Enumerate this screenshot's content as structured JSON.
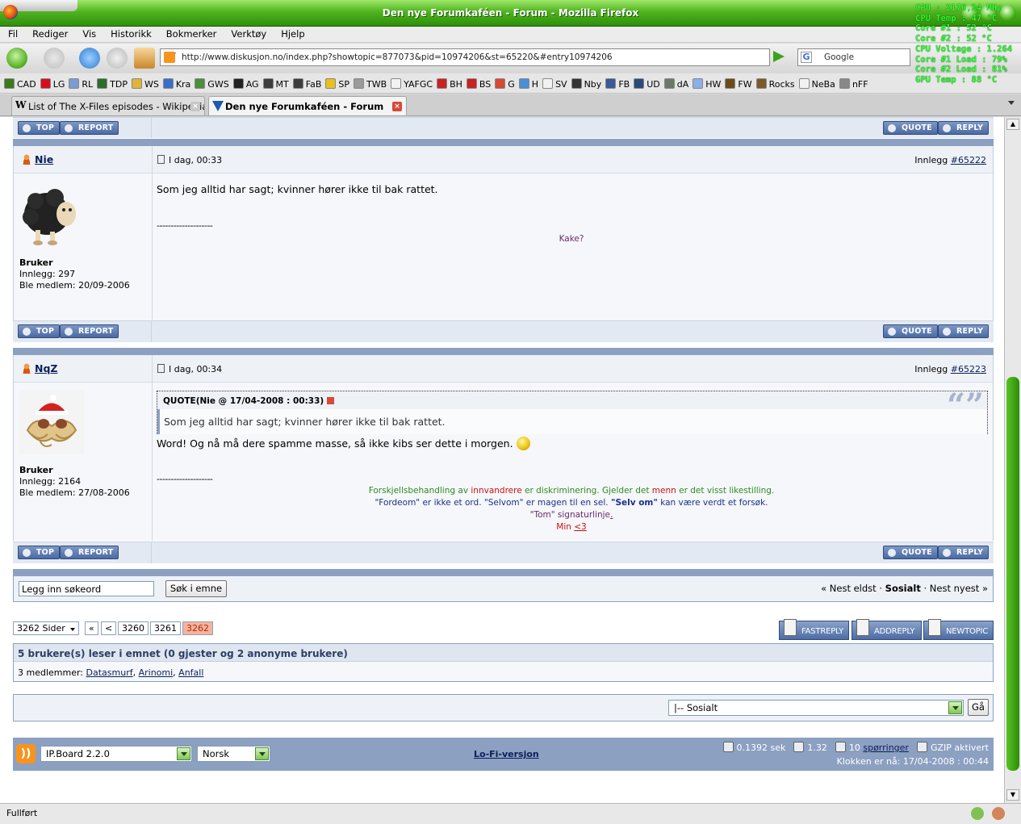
{
  "window": {
    "title": "Den nye Forumkaféen - Forum - Mozilla Firefox",
    "osd": [
      "CPU : 2176,24 MHz",
      "CPU Temp : 47 °C",
      "Core #1 : 52 °C",
      "Core #2 : 52 °C",
      "CPU Voltage : 1.264",
      "Core #1 Load : 79%",
      "Core #2 Load : 81%",
      "GPU Temp : 88 °C"
    ]
  },
  "menu": [
    "Fil",
    "Rediger",
    "Vis",
    "Historikk",
    "Bokmerker",
    "Verktøy",
    "Hjelp"
  ],
  "nav": {
    "url": "http://www.diskusjon.no/index.php?showtopic=877073&pid=10974206&st=65220&#entry10974206",
    "search_placeholder": "Google"
  },
  "bookmarks": [
    {
      "label": "CAD",
      "color": "#3a7a1a"
    },
    {
      "label": "LG",
      "color": "#d40f1c"
    },
    {
      "label": "RL",
      "color": "#7d9bd1"
    },
    {
      "label": "TDP",
      "color": "#2a6e2a"
    },
    {
      "label": "WS",
      "color": "#e0b434"
    },
    {
      "label": "Kra",
      "color": "#3b6ec9"
    },
    {
      "label": "GWS",
      "color": "#4a8f3a"
    },
    {
      "label": "AG",
      "color": "#222222"
    },
    {
      "label": "MT",
      "color": "#3d3d3d"
    },
    {
      "label": "FaB",
      "color": "#3d3d3d"
    },
    {
      "label": "SP",
      "color": "#e8c21c"
    },
    {
      "label": "TWB",
      "color": "#9a9a9a"
    },
    {
      "label": "YAFGC",
      "color": "#f2f2f2"
    },
    {
      "label": "BH",
      "color": "#c82222"
    },
    {
      "label": "BS",
      "color": "#c82222"
    },
    {
      "label": "G",
      "color": "#d64a32"
    },
    {
      "label": "H",
      "color": "#4a8fd6"
    },
    {
      "label": "SV",
      "color": "#f2f2f2"
    },
    {
      "label": "Nby",
      "color": "#333333"
    },
    {
      "label": "FB",
      "color": "#3b5998"
    },
    {
      "label": "UD",
      "color": "#2a4b7a"
    },
    {
      "label": "dA",
      "color": "#6b7a66"
    },
    {
      "label": "HW",
      "color": "#8ab0e6"
    },
    {
      "label": "FW",
      "color": "#6b4a1a"
    },
    {
      "label": "Rocks",
      "color": "#7a5a2a"
    },
    {
      "label": "NeBa",
      "color": "#f2f2f2"
    },
    {
      "label": "nFF",
      "color": "#888888"
    }
  ],
  "tabs": [
    {
      "label": "List of The X-Files episodes - Wikipedia...",
      "active": false
    },
    {
      "label": "Den nye Forumkaféen - Forum",
      "active": true
    }
  ],
  "post_buttons": {
    "top": "TOP",
    "report": "REPORT",
    "quote": "QUOTE",
    "reply": "REPLY"
  },
  "posts": [
    {
      "username": "Nie",
      "date": "I dag, 00:33",
      "post_label": "Innlegg",
      "post_number": "#65222",
      "group": "Bruker",
      "posts_count": "Innlegg: 297",
      "member_since": "Ble medlem: 20/09-2006",
      "text": "Som jeg alltid har sagt; kvinner hører ikke til bak rattet.",
      "sig_sep": "--------------------",
      "sig": "Kake?"
    },
    {
      "username": "NqZ",
      "date": "I dag, 00:34",
      "post_label": "Innlegg",
      "post_number": "#65223",
      "group": "Bruker",
      "posts_count": "Innlegg: 2164",
      "member_since": "Ble medlem: 27/08-2006",
      "quote_header": "QUOTE(Nie @ 17/04-2008 : 00:33)",
      "quote_text": "Som jeg alltid har sagt; kvinner hører ikke til bak rattet.",
      "text": "Word! Og nå må dere spamme masse, så ikke kibs ser dette i morgen.",
      "sig_sep": "--------------------",
      "sig": {
        "l1a": "Forskjellsbehandling av ",
        "l1b": "innvandrere",
        "l1c": " er diskriminering. Gjelder det ",
        "l1d": "menn",
        "l1e": " er det visst likestilling.",
        "l2a": "\"Fordeom\" er ikke et ord. \"Selvom\" er magen til en sel. ",
        "l2b": "\"Selv om\"",
        "l2c": " kan være verdt et forsøk.",
        "l3a": "\"Tom\" signaturlinje",
        "l3b": ".",
        "l4a": "Min ",
        "l4b": "<3"
      },
      "sig_colors": {
        "green": "#2e8b1e",
        "red": "#cc1111",
        "blue": "#1c2f8c",
        "purple": "#6a2b6a"
      }
    }
  ],
  "search": {
    "placeholder": "Legg inn søkeord",
    "button": "Søk i emne"
  },
  "topic_nav": {
    "prev": "« Nest eldst",
    "sep1": " · ",
    "forum": "Sosialt",
    "sep2": " · ",
    "next": "Nest nyest »"
  },
  "pagination": {
    "pages_label": "3262 Sider",
    "first": "«",
    "prev": "<",
    "p1": "3260",
    "p2": "3261",
    "current": "3262"
  },
  "action_buttons": {
    "fastreply": "FASTREPLY",
    "addreply": "ADDREPLY",
    "newtopic": "NEWTOPIC"
  },
  "active_users": {
    "header": "5 brukere(s) leser i emnet (0 gjester og 2 anonyme brukere)",
    "members_label": "3 medlemmer: ",
    "members": [
      "Datasmurf",
      "Arinomi",
      "Anfall"
    ]
  },
  "jump": {
    "selected": "|-- Sosialt",
    "button": "Gå"
  },
  "footer": {
    "skin": "IP.Board 2.2.0",
    "language": "Norsk",
    "lofi": "Lo-Fi-versjon",
    "time": "0.1392 sek",
    "load": "1.32",
    "queries_count": "10",
    "queries_label": "spørringer",
    "gzip": "GZIP aktivert",
    "clock": "Klokken er nå: 17/04-2008 : 00:44"
  },
  "statusbar": "Fullført"
}
